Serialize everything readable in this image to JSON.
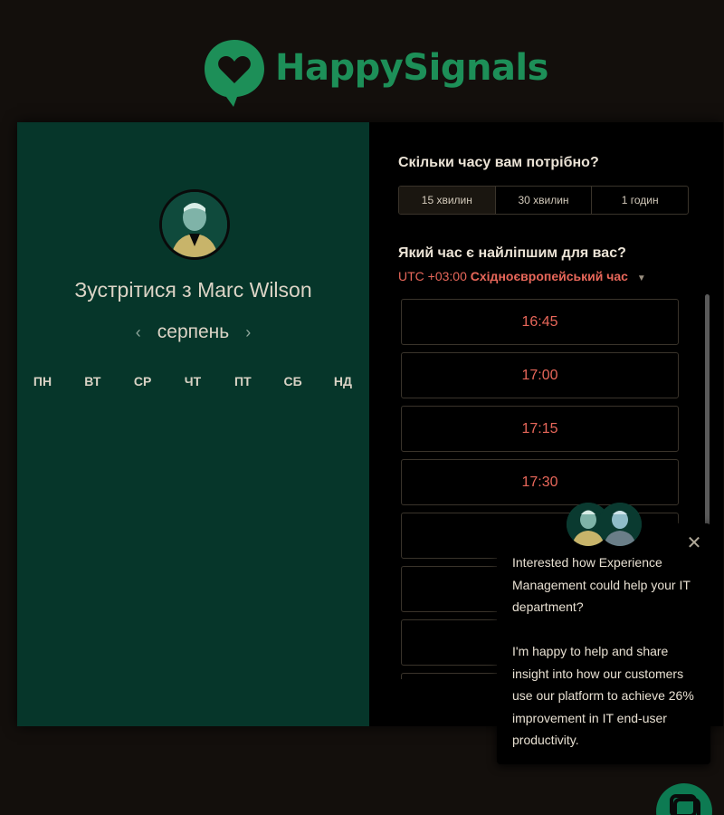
{
  "brand": {
    "name": "HappySignals",
    "color": "#1d8f58"
  },
  "left": {
    "meet_prefix": "Зустрітися з",
    "person_name": "Marc Wilson",
    "month": "серпень",
    "prev_icon": "chevron-left-icon",
    "next_icon": "chevron-right-icon",
    "weekdays": [
      "ПН",
      "ВТ",
      "СР",
      "ЧТ",
      "ПТ",
      "СБ",
      "НД"
    ],
    "background": "#06362a"
  },
  "right": {
    "duration_question": "Скільки часу вам потрібно?",
    "durations": [
      "15 хвилин",
      "30 хвилин",
      "1 годин"
    ],
    "selected_duration": "15 хвилин",
    "time_question": "Який час є найліпшим для вас?",
    "timezone_offset": "UTC +03:00",
    "timezone_name": "Східноєвропейський час",
    "slots": [
      "16:45",
      "17:00",
      "17:15",
      "17:30",
      "",
      "",
      "",
      ""
    ],
    "accent": "#e8675a"
  },
  "chat": {
    "paragraph1": "Interested how Experience Management could help your IT department?",
    "paragraph2": "I'm happy to help and share insight into how our customers use our platform to achieve 26% improvement in IT end-user productivity.",
    "close_icon": "close-icon",
    "fab_icon": "chat-icon"
  }
}
